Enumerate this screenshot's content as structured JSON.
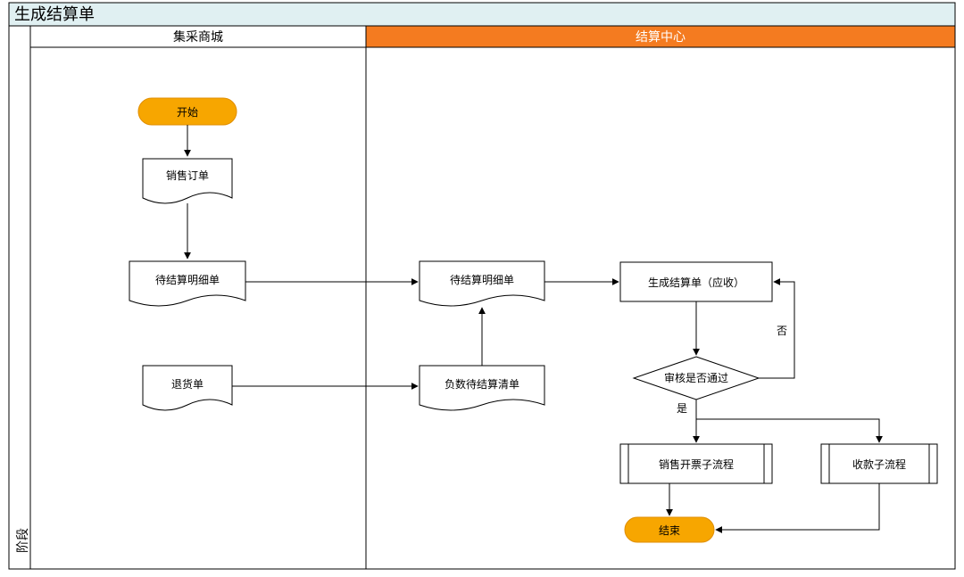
{
  "title": "生成结算单",
  "phase_label": "阶段",
  "lanes": {
    "left": {
      "header": "集采商城"
    },
    "right": {
      "header": "结算中心"
    }
  },
  "nodes": {
    "start": "开始",
    "sales_order": "销售订单",
    "pending_detail_left": "待结算明细单",
    "return_order": "退货单",
    "pending_detail_right": "待结算明细单",
    "negative_pending": "负数待结算清单",
    "gen_settlement": "生成结算单（应收）",
    "approve": "审核是否通过",
    "sales_invoice_sub": "销售开票子流程",
    "receipt_sub": "收款子流程",
    "end": "结束"
  },
  "edges": {
    "yes": "是",
    "no": "否"
  },
  "colors": {
    "title_bg": "#e0f0f2",
    "lane_right_header_bg": "#f47b20",
    "lane_right_header_text": "#ffffff",
    "terminator_fill": "#f7a600",
    "terminator_stroke": "#e08e00",
    "border": "#000000"
  }
}
